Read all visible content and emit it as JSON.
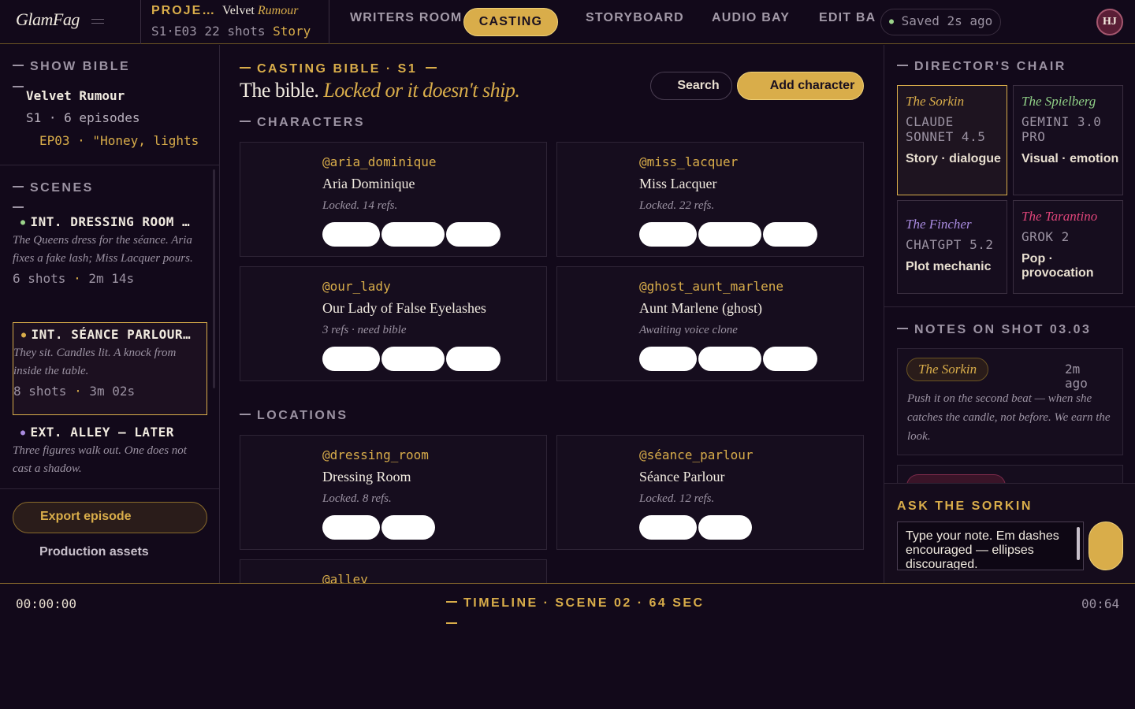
{
  "app": {
    "logo": "GlamFag"
  },
  "project": {
    "label": "PROJE…",
    "name": "Velvet",
    "name_italic": "Rumour",
    "meta": "S1·E03 22 shots",
    "meta_accent": "Story"
  },
  "nav": {
    "tabs": [
      "WRITERS ROOM",
      "CASTING",
      "STORYBOARD",
      "AUDIO BAY",
      "EDIT BA"
    ],
    "active": "CASTING"
  },
  "status": {
    "saved": "Saved 2s ago"
  },
  "user": {
    "initials": "HJ"
  },
  "sidebar": {
    "bible_head": "SHOW BIBLE",
    "show": "Velvet Rumour",
    "season": "S1 · 6 episodes",
    "episode": "EP03 · \"Honey, lights",
    "scenes_head": "SCENES",
    "scenes": [
      {
        "title": "INT. DRESSING ROOM …",
        "dot_color": "#9bd38a",
        "desc": "The Queens dress for the séance. Aria fixes a fake lash; Miss Lacquer pours.",
        "shots": "6 shots",
        "duration": "2m 14s"
      },
      {
        "title": "INT. SÉANCE PARLOUR…",
        "dot_color": "#d9ad4a",
        "desc": "They sit. Candles lit. A knock from inside the table.",
        "shots": "8 shots",
        "duration": "3m 02s"
      },
      {
        "title": "EXT. ALLEY — LATER",
        "dot_color": "#a98be0",
        "desc": "Three figures walk out. One does not cast a shadow.",
        "shots": "",
        "duration": ""
      }
    ],
    "export_label": "Export episode",
    "assets_label": "Production assets"
  },
  "main": {
    "kicker": "CASTING BIBLE · S1",
    "headline": "The bible.",
    "headline_italic": "Locked or it doesn't ship.",
    "search_label": "Search",
    "add_label": "Add character",
    "characters_head": "CHARACTERS",
    "locations_head": "LOCATIONS",
    "characters": [
      {
        "handle": "@aria_dominique",
        "name": "Aria Dominique",
        "note": "Locked. 14 refs."
      },
      {
        "handle": "@miss_lacquer",
        "name": "Miss Lacquer",
        "note": "Locked. 22 refs."
      },
      {
        "handle": "@our_lady",
        "name": "Our Lady of False Eyelashes",
        "note": "3 refs · need bible"
      },
      {
        "handle": "@ghost_aunt_marlene",
        "name": "Aunt Marlene (ghost)",
        "note": "Awaiting voice clone"
      }
    ],
    "locations": [
      {
        "handle": "@dressing_room",
        "name": "Dressing Room",
        "note": "Locked. 8 refs."
      },
      {
        "handle": "@séance_parlour",
        "name": "Séance Parlour",
        "note": "Locked. 12 refs."
      },
      {
        "handle": "@alley",
        "name": "",
        "note": ""
      }
    ]
  },
  "right": {
    "chair_head": "DIRECTOR'S CHAIR",
    "directors": [
      {
        "name": "The Sorkin",
        "model": "CLAUDE SONNET 4.5",
        "role": "Story · dialogue",
        "color": "#d9ad4a"
      },
      {
        "name": "The Spielberg",
        "model": "GEMINI 3.0 PRO",
        "role": "Visual · emotion",
        "color": "#8fcf86"
      },
      {
        "name": "The Fincher",
        "model": "CHATGPT 5.2",
        "role": "Plot mechanic",
        "color": "#a98be0"
      },
      {
        "name": "The Tarantino",
        "model": "GROK 2",
        "role": "Pop · provocation",
        "color": "#e0457a"
      }
    ],
    "notes_head": "NOTES ON SHOT 03.03",
    "note": {
      "author": "The Sorkin",
      "time": "2m ago",
      "text": "Push it on the second beat — when she catches the candle, not before. We earn the look."
    },
    "ask_head": "ASK THE SORKIN",
    "ask_placeholder": "Type your note. Em dashes encouraged — ellipses discouraged."
  },
  "timeline": {
    "start": "00:00:00",
    "title": "TIMELINE · SCENE 02 · 64 SEC",
    "end": "00:64"
  },
  "colors": {
    "accent": "#d9ad4a",
    "background": "#12091a",
    "card": "#160d1e"
  }
}
